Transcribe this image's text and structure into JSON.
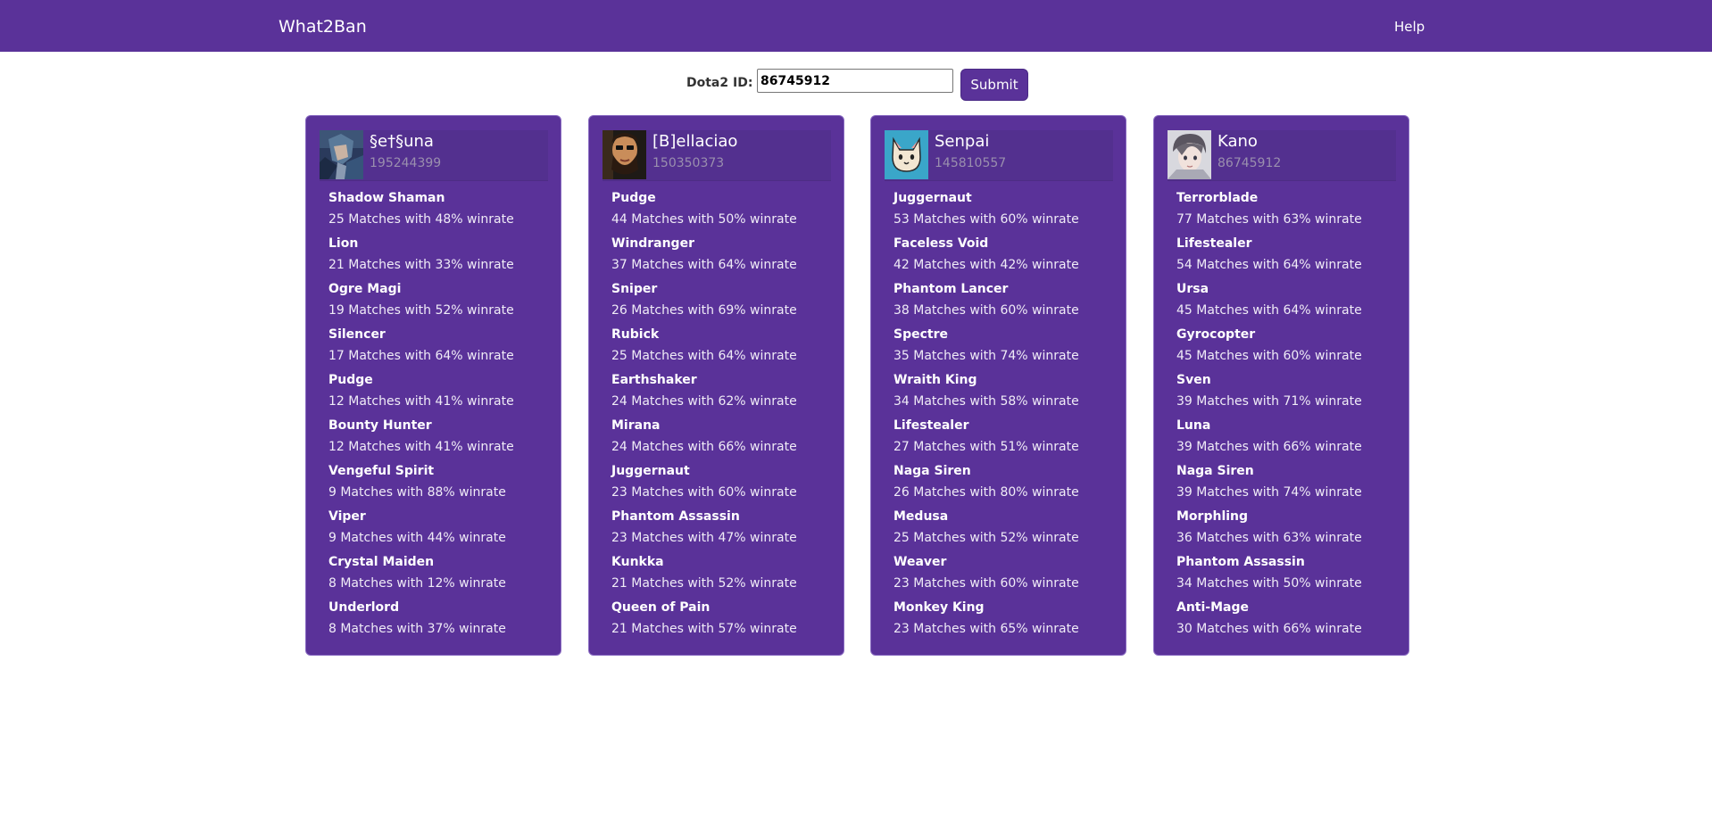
{
  "nav": {
    "brand": "What2Ban",
    "help": "Help"
  },
  "search": {
    "label": "Dota2 ID:",
    "value": "86745912",
    "submit_label": "Submit"
  },
  "colors": {
    "primary": "#5a3299",
    "card_border": "#8a6cc2",
    "id_text": "#9a8fae"
  },
  "players": [
    {
      "name": "§e†§una",
      "id": "195244399",
      "avatar": "anime-character-avatar",
      "heroes": [
        {
          "name": "Shadow Shaman",
          "stats": "25 Matches with 48% winrate"
        },
        {
          "name": "Lion",
          "stats": "21 Matches with 33% winrate"
        },
        {
          "name": "Ogre Magi",
          "stats": "19 Matches with 52% winrate"
        },
        {
          "name": "Silencer",
          "stats": "17 Matches with 64% winrate"
        },
        {
          "name": "Pudge",
          "stats": "12 Matches with 41% winrate"
        },
        {
          "name": "Bounty Hunter",
          "stats": "12 Matches with 41% winrate"
        },
        {
          "name": "Vengeful Spirit",
          "stats": "9 Matches with 88% winrate"
        },
        {
          "name": "Viper",
          "stats": "9 Matches with 44% winrate"
        },
        {
          "name": "Crystal Maiden",
          "stats": "8 Matches with 12% winrate"
        },
        {
          "name": "Underlord",
          "stats": "8 Matches with 37% winrate"
        }
      ]
    },
    {
      "name": "[B]ellaciao",
      "id": "150350373",
      "avatar": "bearded-man-avatar",
      "heroes": [
        {
          "name": "Pudge",
          "stats": "44 Matches with 50% winrate"
        },
        {
          "name": "Windranger",
          "stats": "37 Matches with 64% winrate"
        },
        {
          "name": "Sniper",
          "stats": "26 Matches with 69% winrate"
        },
        {
          "name": "Rubick",
          "stats": "25 Matches with 64% winrate"
        },
        {
          "name": "Earthshaker",
          "stats": "24 Matches with 62% winrate"
        },
        {
          "name": "Mirana",
          "stats": "24 Matches with 66% winrate"
        },
        {
          "name": "Juggernaut",
          "stats": "23 Matches with 60% winrate"
        },
        {
          "name": "Phantom Assassin",
          "stats": "23 Matches with 47% winrate"
        },
        {
          "name": "Kunkka",
          "stats": "21 Matches with 52% winrate"
        },
        {
          "name": "Queen of Pain",
          "stats": "21 Matches with 57% winrate"
        }
      ]
    },
    {
      "name": "Senpai",
      "id": "145810557",
      "avatar": "cat-avatar",
      "heroes": [
        {
          "name": "Juggernaut",
          "stats": "53 Matches with 60% winrate"
        },
        {
          "name": "Faceless Void",
          "stats": "42 Matches with 42% winrate"
        },
        {
          "name": "Phantom Lancer",
          "stats": "38 Matches with 60% winrate"
        },
        {
          "name": "Spectre",
          "stats": "35 Matches with 74% winrate"
        },
        {
          "name": "Wraith King",
          "stats": "34 Matches with 58% winrate"
        },
        {
          "name": "Lifestealer",
          "stats": "27 Matches with 51% winrate"
        },
        {
          "name": "Naga Siren",
          "stats": "26 Matches with 80% winrate"
        },
        {
          "name": "Medusa",
          "stats": "25 Matches with 52% winrate"
        },
        {
          "name": "Weaver",
          "stats": "23 Matches with 60% winrate"
        },
        {
          "name": "Monkey King",
          "stats": "23 Matches with 65% winrate"
        }
      ]
    },
    {
      "name": "Kano",
      "id": "86745912",
      "avatar": "anime-portrait-avatar",
      "heroes": [
        {
          "name": "Terrorblade",
          "stats": "77 Matches with 63% winrate"
        },
        {
          "name": "Lifestealer",
          "stats": "54 Matches with 64% winrate"
        },
        {
          "name": "Ursa",
          "stats": "45 Matches with 64% winrate"
        },
        {
          "name": "Gyrocopter",
          "stats": "45 Matches with 60% winrate"
        },
        {
          "name": "Sven",
          "stats": "39 Matches with 71% winrate"
        },
        {
          "name": "Luna",
          "stats": "39 Matches with 66% winrate"
        },
        {
          "name": "Naga Siren",
          "stats": "39 Matches with 74% winrate"
        },
        {
          "name": "Morphling",
          "stats": "36 Matches with 63% winrate"
        },
        {
          "name": "Phantom Assassin",
          "stats": "34 Matches with 50% winrate"
        },
        {
          "name": "Anti-Mage",
          "stats": "30 Matches with 66% winrate"
        }
      ]
    }
  ]
}
